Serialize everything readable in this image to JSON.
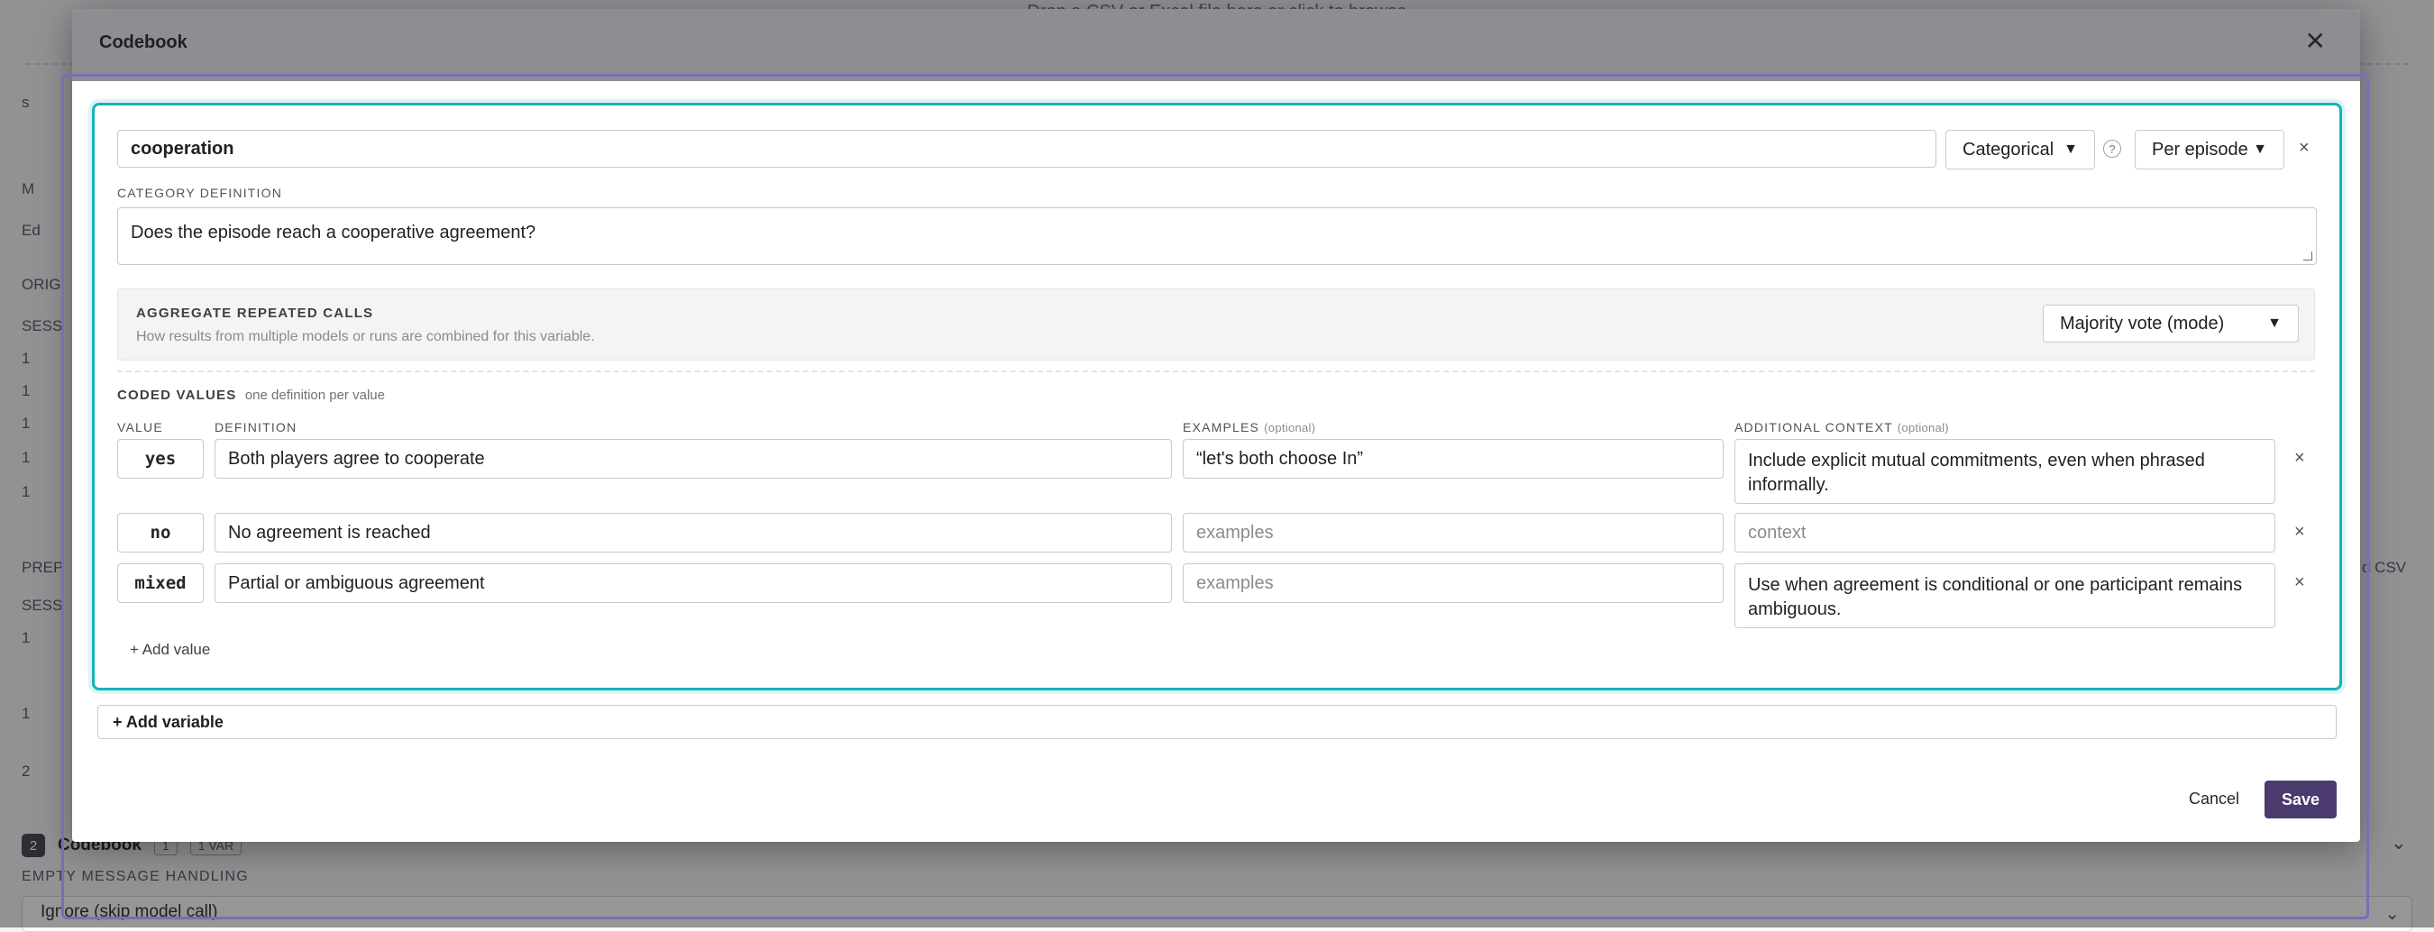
{
  "background": {
    "top_banner": "Drop a CSV or Excel file here or click to browse",
    "step": {
      "number": "2",
      "title": "Codebook",
      "count": "1",
      "badge": "1 VAR"
    },
    "empty_handling": {
      "label": "EMPTY MESSAGE HANDLING",
      "value": "Ignore (skip model call)"
    },
    "row_fragments": [
      "s",
      "M",
      "Ed",
      "ORIG",
      "SESS",
      "1",
      "1",
      "1",
      "1",
      "1",
      "PREP",
      "SESS",
      "1",
      "1",
      "2"
    ],
    "right_fragment": "d CSV"
  },
  "modal": {
    "title": "Codebook",
    "close_icon": "close-icon",
    "cancel_label": "Cancel",
    "save_label": "Save",
    "add_variable_label": "+ Add variable"
  },
  "variable": {
    "name": "cooperation",
    "type_select": {
      "value": "Categorical"
    },
    "help_icon_text": "?",
    "scope_select": {
      "value": "Per episode"
    },
    "category_definition_label": "CATEGORY DEFINITION",
    "category_definition": "Does the episode reach a cooperative agreement?",
    "aggregate": {
      "title": "AGGREGATE REPEATED CALLS",
      "subtitle": "How results from multiple models or runs are combined for this variable.",
      "value": "Majority vote (mode)"
    },
    "coded_values": {
      "title": "CODED VALUES",
      "hint": "one definition per value",
      "col_value": "VALUE",
      "col_definition": "DEFINITION",
      "col_examples": "EXAMPLES",
      "col_examples_opt": "(optional)",
      "col_context": "ADDITIONAL CONTEXT",
      "col_context_opt": "(optional)",
      "examples_placeholder": "examples",
      "context_placeholder": "context",
      "add_value_label": "+ Add value",
      "rows": [
        {
          "value": "yes",
          "definition": "Both players agree to cooperate",
          "examples": "“let's both choose In”",
          "context": "Include explicit mutual commitments, even when phrased informally."
        },
        {
          "value": "no",
          "definition": "No agreement is reached",
          "examples": "",
          "context": ""
        },
        {
          "value": "mixed",
          "definition": "Partial or ambiguous agreement",
          "examples": "",
          "context": "Use when agreement is conditional or one participant remains ambiguous."
        }
      ]
    }
  },
  "colors": {
    "accent_teal": "#16b3ba",
    "frame_purple": "#7d6cb5",
    "save_button": "#4a3a6e"
  }
}
